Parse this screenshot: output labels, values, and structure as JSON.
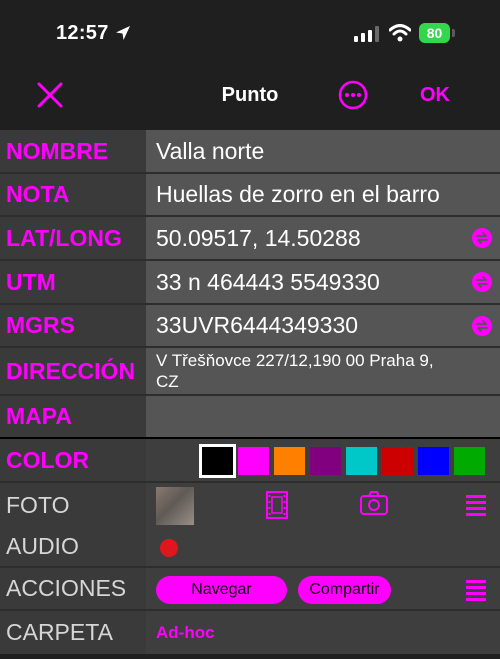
{
  "status_bar": {
    "time": "12:57",
    "battery": "80"
  },
  "nav": {
    "title": "Punto",
    "ok_label": "OK"
  },
  "accent": "#ff00ff",
  "fields": {
    "nombre": {
      "label": "NOMBRE",
      "value": "Valla norte"
    },
    "nota": {
      "label": "NOTA",
      "value": "Huellas de zorro en el barro"
    },
    "latlong": {
      "label": "LAT/LONG",
      "value": "50.09517, 14.50288"
    },
    "utm": {
      "label": "UTM",
      "value": "33 n 464443 5549330"
    },
    "mgrs": {
      "label": "MGRS",
      "value": "33UVR6444349330"
    },
    "direccion": {
      "label": "DIRECCIÓN",
      "value": "V Třešňovce 227/12,190 00 Praha 9, CZ"
    },
    "mapa": {
      "label": "MAPA"
    },
    "color": {
      "label": "COLOR",
      "swatches": [
        "#000000",
        "#ff00ff",
        "#ff8000",
        "#800080",
        "#00c8c8",
        "#cc0000",
        "#0000ff",
        "#00aa00"
      ],
      "selected": "#000000"
    },
    "foto": {
      "label": "FOTO"
    },
    "audio": {
      "label": "AUDIO"
    },
    "acciones": {
      "label": "ACCIONES",
      "navegar": "Navegar",
      "compartir": "Compartir"
    },
    "carpeta": {
      "label": "CARPETA",
      "value": "Ad-hoc"
    }
  },
  "icons": [
    "location-arrow-icon",
    "signal-icon",
    "wifi-icon",
    "battery-icon",
    "close-icon",
    "more-icon",
    "swap-icon",
    "film-icon",
    "camera-icon",
    "menu-icon",
    "record-icon"
  ]
}
